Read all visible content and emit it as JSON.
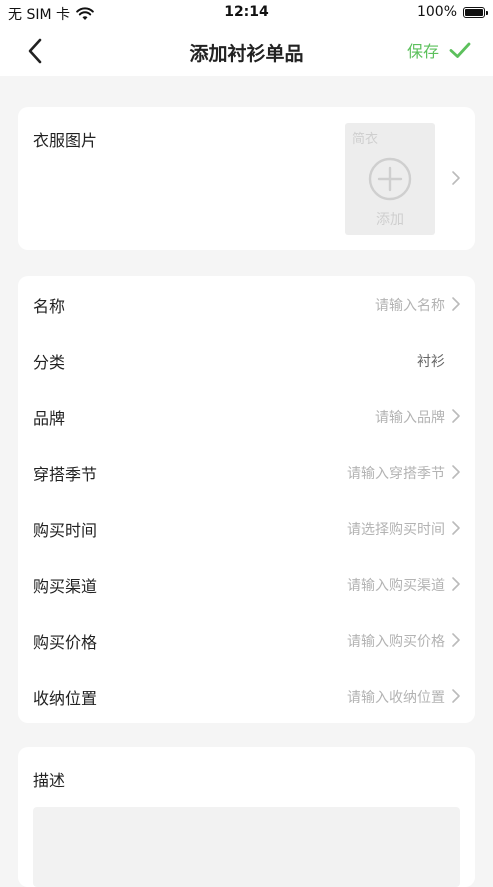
{
  "status": {
    "carrier": "无 SIM 卡",
    "time": "12:14",
    "battery": "100%"
  },
  "nav": {
    "title": "添加衬衫单品",
    "save_label": "保存",
    "accent": "#5cc05c"
  },
  "photo": {
    "label": "衣服图片",
    "watermark": "简衣",
    "add_label": "添加"
  },
  "form": {
    "rows": [
      {
        "label": "名称",
        "value": "请输入名称"
      },
      {
        "label": "分类",
        "value": "衬衫"
      },
      {
        "label": "品牌",
        "value": "请输入品牌"
      },
      {
        "label": "穿搭季节",
        "value": "请输入穿搭季节"
      },
      {
        "label": "购买时间",
        "value": "请选择购买时间"
      },
      {
        "label": "购买渠道",
        "value": "请输入购买渠道"
      },
      {
        "label": "购买价格",
        "value": "请输入购买价格"
      },
      {
        "label": "收纳位置",
        "value": "请输入收纳位置"
      }
    ]
  },
  "description": {
    "label": "描述"
  }
}
